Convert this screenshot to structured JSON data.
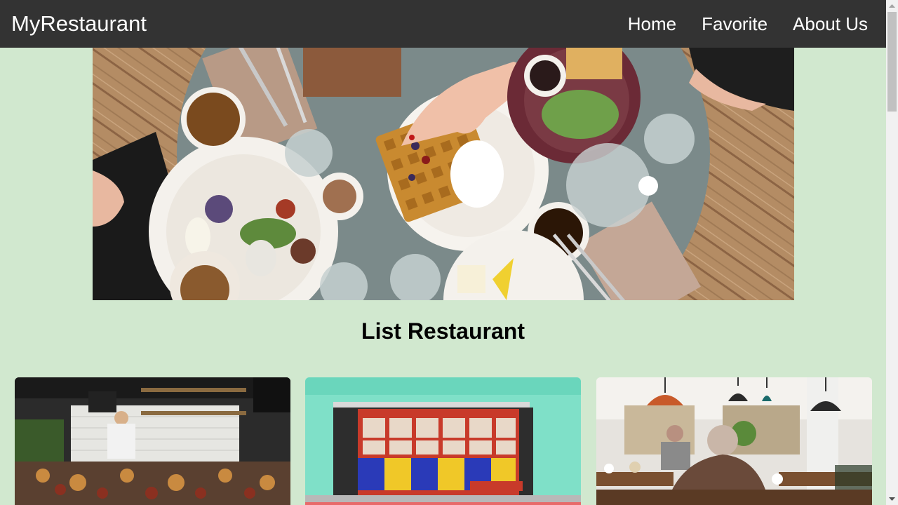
{
  "navbar": {
    "brand": "MyRestaurant",
    "links": [
      "Home",
      "Favorite",
      "About Us"
    ]
  },
  "main": {
    "section_title": "List Restaurant"
  },
  "colors": {
    "page_background": "#d1e8cf",
    "navbar_background": "#333333",
    "navbar_text": "#ffffff"
  }
}
